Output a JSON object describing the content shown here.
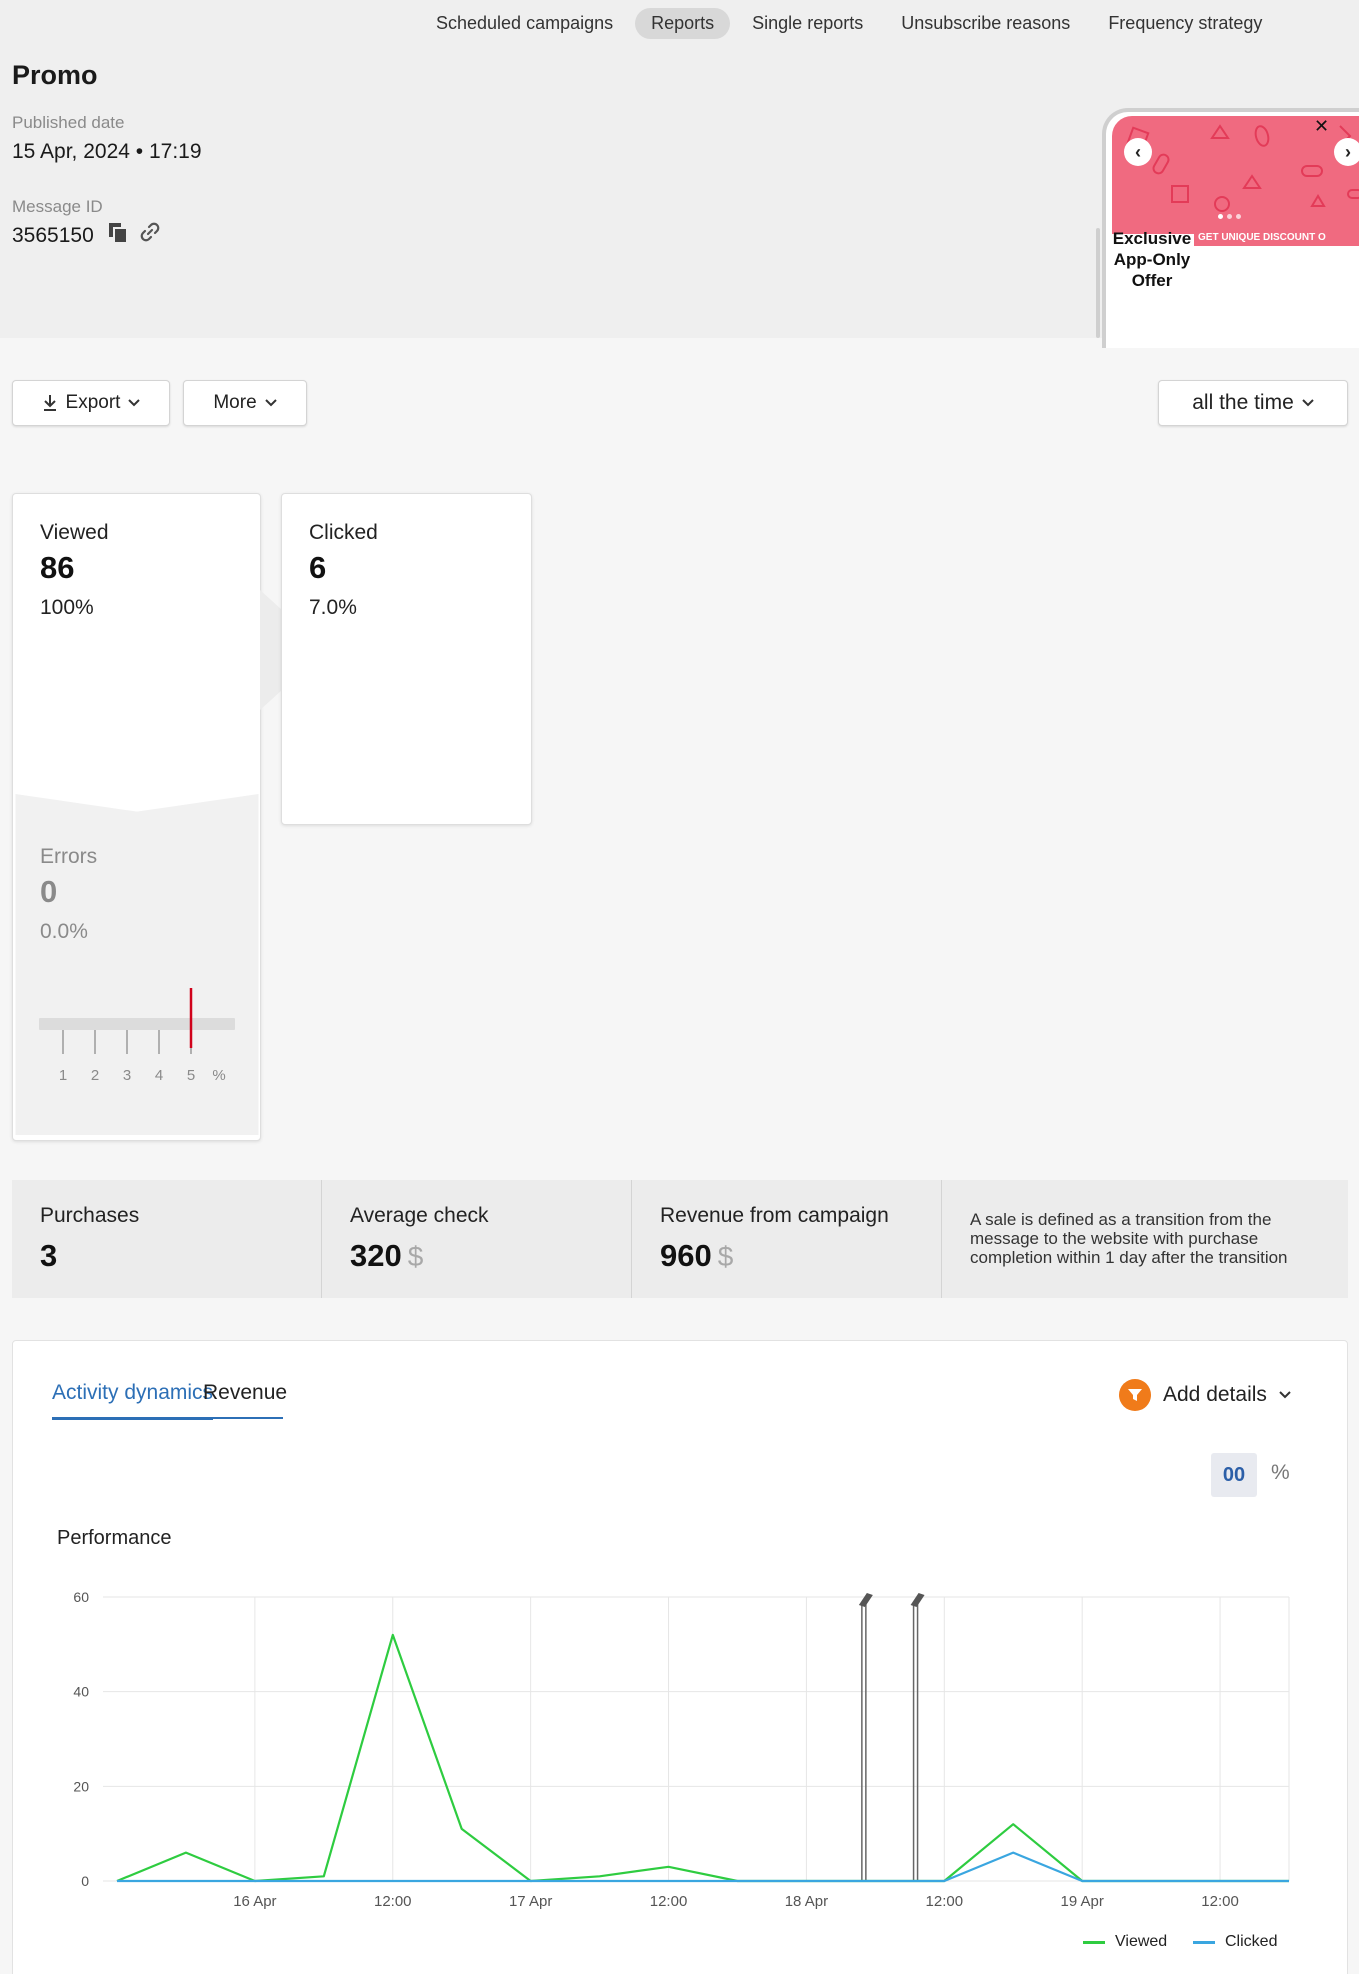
{
  "topnav": {
    "tabs": [
      "Scheduled campaigns",
      "Reports",
      "Single reports",
      "Unsubscribe reasons",
      "Frequency strategy"
    ],
    "active": "Reports"
  },
  "campaign": {
    "title": "Promo",
    "published_label": "Published date",
    "published_value": "15 Apr, 2024 • 17:19",
    "message_id_label": "Message ID",
    "message_id_value": "3565150"
  },
  "preview": {
    "headline": "Exclusive App-Only Offer",
    "strip_text": "GET UNIQUE DISCOUNT O"
  },
  "toolbar": {
    "export_label": "Export",
    "more_label": "More",
    "period_label": "all the time"
  },
  "stats": {
    "viewed": {
      "label": "Viewed",
      "value": "86",
      "percent": "100%"
    },
    "clicked": {
      "label": "Clicked",
      "value": "6",
      "percent": "7.0%"
    },
    "errors": {
      "label": "Errors",
      "value": "0",
      "percent": "0.0%"
    },
    "error_scale": {
      "ticks": [
        "1",
        "2",
        "3",
        "4",
        "5"
      ],
      "unit": "%",
      "threshold_percent": 5
    }
  },
  "money": {
    "purchases": {
      "label": "Purchases",
      "value": "3"
    },
    "average_check": {
      "label": "Average check",
      "value": "320",
      "currency": "$"
    },
    "revenue": {
      "label": "Revenue from campaign",
      "value": "960",
      "currency": "$"
    },
    "note": "A sale is defined as a transition from the message to the website with purchase completion within 1 day after the transition"
  },
  "panel": {
    "tabs": [
      "Activity dynamics",
      "Revenue"
    ],
    "active_tab": "Activity dynamics",
    "add_details_label": "Add details",
    "toggle_absolute": "00",
    "toggle_percent": "%",
    "chart_title": "Performance"
  },
  "colors": {
    "viewed": "#2ecc40",
    "clicked": "#3aa6e0",
    "accent": "#2c6fb6",
    "funnel": "#f07b1a",
    "error_marker": "#d0021b"
  },
  "chart_data": {
    "type": "line",
    "x_tick_labels": [
      "16 Apr",
      "12:00",
      "17 Apr",
      "12:00",
      "18 Apr",
      "12:00",
      "19 Apr",
      "12:00"
    ],
    "x_hours": [
      0,
      6,
      12,
      18,
      24,
      30,
      36,
      42,
      48,
      54,
      60,
      66,
      72,
      78,
      84,
      90,
      96,
      102
    ],
    "x_ticks_hours": [
      12,
      24,
      36,
      48,
      60,
      72,
      84,
      96
    ],
    "xlim": [
      0,
      102
    ],
    "ylim": [
      0,
      60
    ],
    "yticks": [
      0,
      20,
      40,
      60
    ],
    "series": [
      {
        "name": "Viewed",
        "values": [
          0,
          6,
          0,
          1,
          52,
          11,
          0,
          1,
          3,
          0,
          0,
          0,
          0,
          12,
          0,
          0,
          0,
          0
        ]
      },
      {
        "name": "Clicked",
        "values": [
          0,
          0,
          0,
          0,
          0,
          0,
          0,
          0,
          0,
          0,
          0,
          0,
          0,
          6,
          0,
          0,
          0,
          0
        ]
      }
    ],
    "markers_hours": [
      65,
      69.5
    ],
    "grid": true,
    "legend": "bottom-right"
  }
}
